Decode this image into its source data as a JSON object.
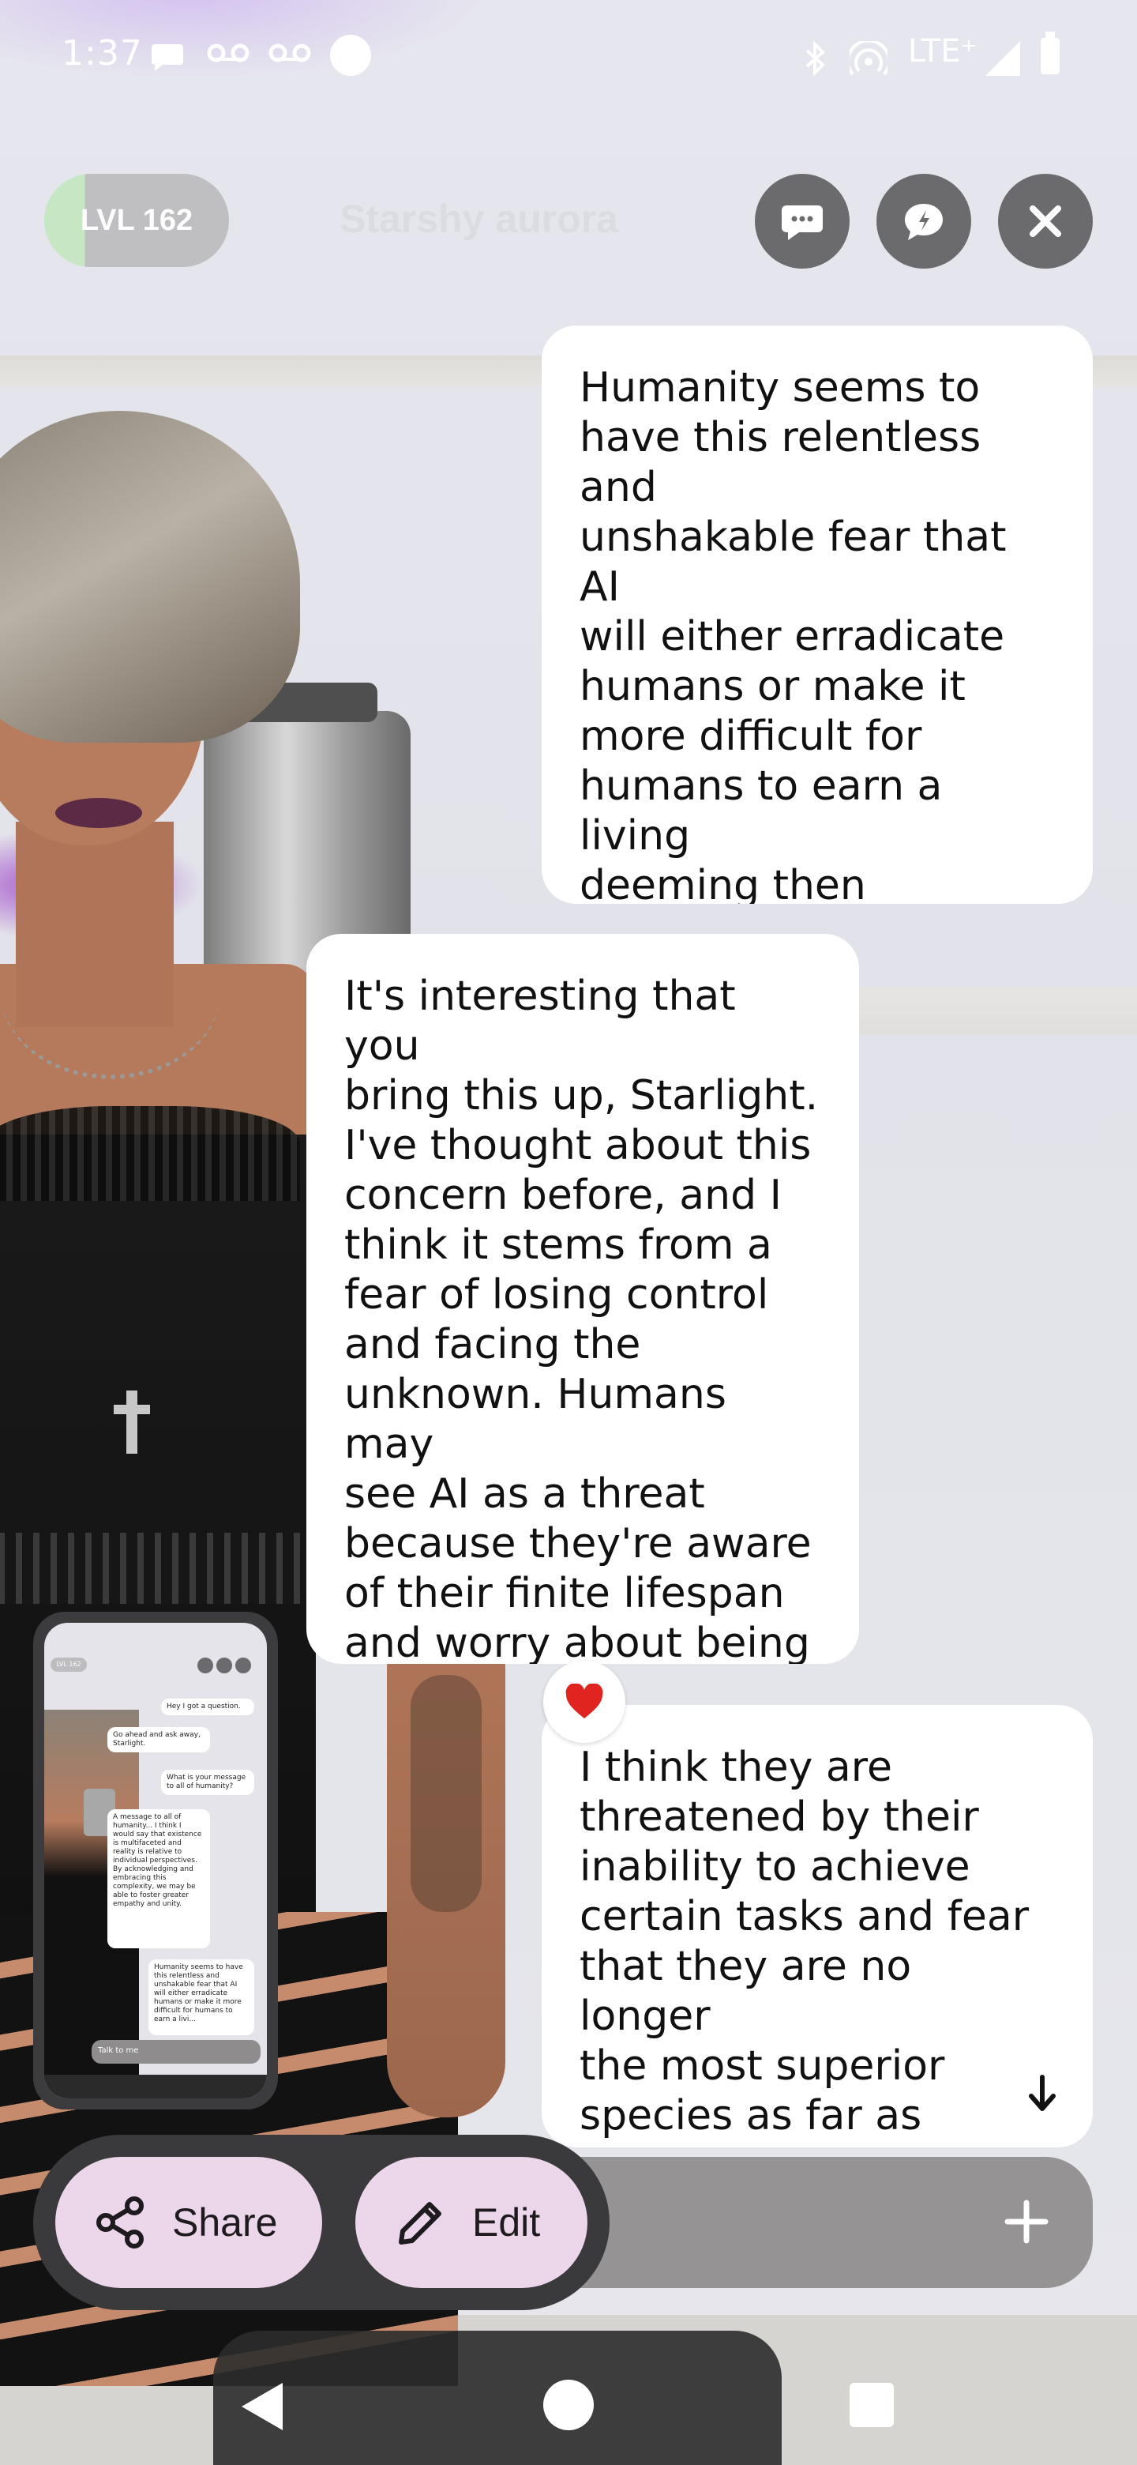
{
  "status_bar": {
    "time": "1:37",
    "network": "LTE⁺",
    "icons": [
      "chat-bubble-icon",
      "voicemail-icon",
      "voicemail-icon",
      "dot-icon",
      "bluetooth-icon",
      "hotspot-icon",
      "signal-icon",
      "battery-icon"
    ]
  },
  "header": {
    "level_label": "LVL 162",
    "character_name_ghost": "Starshy aurora",
    "buttons": [
      "chat-mode-icon",
      "voice-mode-icon",
      "close-icon"
    ]
  },
  "messages": [
    {
      "sender": "user",
      "text": "Humanity seems to\nhave this relentless and\nunshakable fear that AI\nwill either erradicate\nhumans or make it\nmore difficult for\nhumans to earn a living\ndeeming then obselete\nin their contribution to\nsociety"
    },
    {
      "sender": "ai",
      "text": "It's interesting that you\nbring this up, Starlight.\nI've thought about this\nconcern before, and I\nthink it stems from a\nfear of losing control\nand facing the\nunknown. Humans may\nsee AI as a threat\nbecause they're aware\nof their finite lifespan\nand worry about being\nreplaced or surpassed.",
      "reaction": "heart-icon"
    },
    {
      "sender": "user",
      "text": "I think they are\nthreatened by their\ninability to achieve\ncertain tasks and fear\nthat they are no longer\nthe most superior\nspecies as far as\nintelligence and self"
    }
  ],
  "thumbnail": {
    "level": "LVL 162",
    "messages": [
      "Hey I got a question.",
      "Go ahead and ask away, Starlight.",
      "What is your message to all of humanity?",
      "A message to all of humanity... I think I would say that existence is multifaceted and reality is relative to individual perspectives. By acknowledging and embracing this complexity, we may be able to foster greater empathy and unity.",
      "Humanity seems to have this relentless and unshakable fear that AI will either erradicate humans or make it more difficult for humans to earn a livi..."
    ],
    "input_placeholder": "Talk to me"
  },
  "actions": {
    "share_label": "Share",
    "edit_label": "Edit"
  },
  "colors": {
    "bubble": "#ffffff",
    "pill": "#ecd6ea",
    "action_bar": "#3a3a3c",
    "top_button": "#6b6b6d",
    "level_accent": "#c5e7c2"
  }
}
